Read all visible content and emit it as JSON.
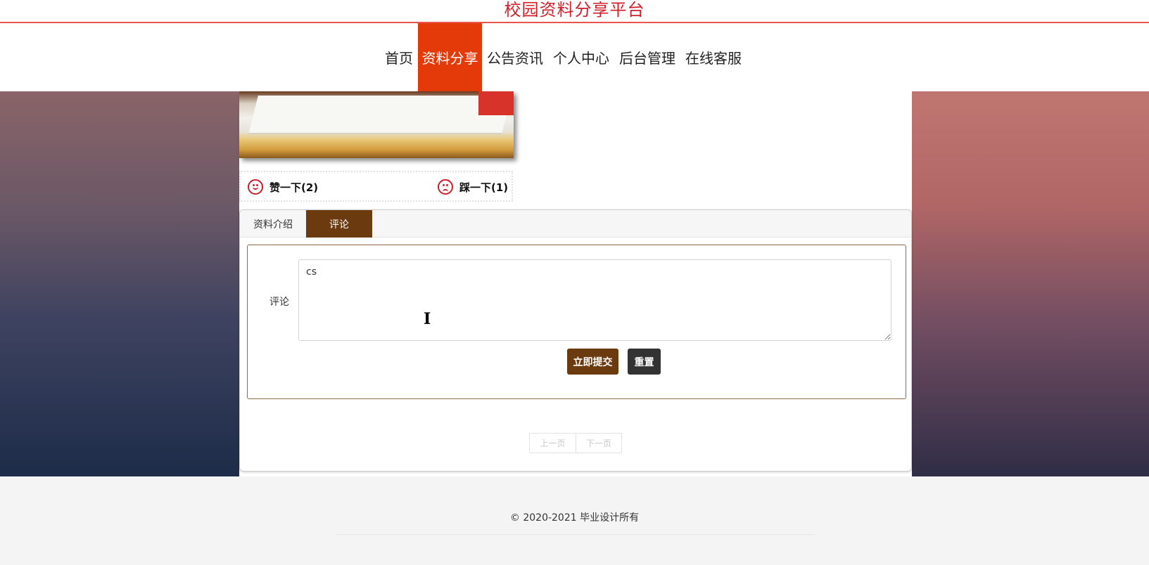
{
  "header": {
    "site_title": "校园资料分享平台"
  },
  "nav": {
    "items": [
      {
        "label": "首页"
      },
      {
        "label": "资料分享",
        "active": true
      },
      {
        "label": "公告资讯"
      },
      {
        "label": "个人中心"
      },
      {
        "label": "后台管理"
      },
      {
        "label": "在线客服"
      }
    ],
    "active_color": "#e43a0a"
  },
  "votes": {
    "like_label": "赞一下(2)",
    "dislike_label": "踩一下(1)"
  },
  "tabs": {
    "items": [
      {
        "label": "资料介绍"
      },
      {
        "label": "评论",
        "active": true
      }
    ],
    "accent_color": "#6b3a0e"
  },
  "comment_form": {
    "label": "评论",
    "value": "cs",
    "submit_label": "立即提交",
    "reset_label": "重置"
  },
  "pager": {
    "prev_label": "上一页",
    "next_label": "下一页"
  },
  "footer": {
    "copyright": "© 2020-2021 毕业设计所有"
  }
}
